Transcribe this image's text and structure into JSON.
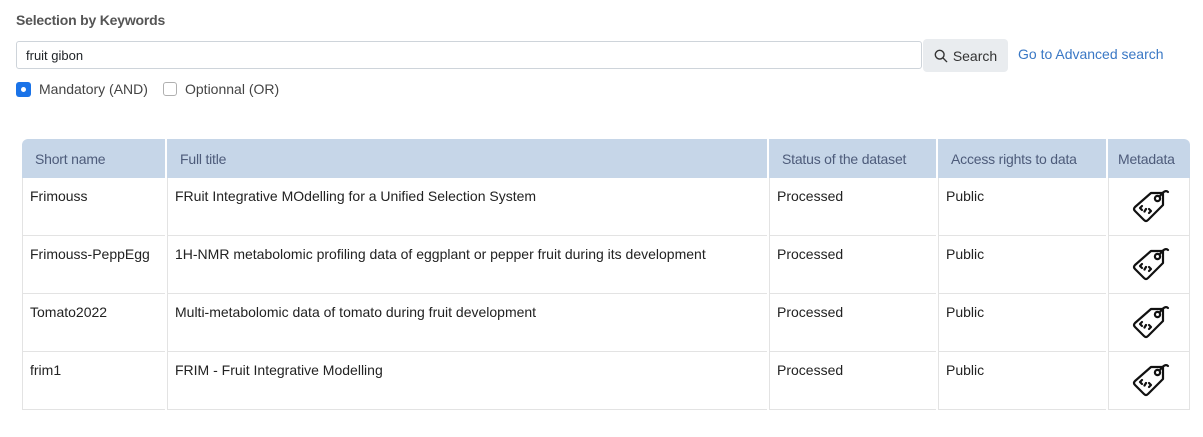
{
  "section": {
    "title": "Selection by Keywords"
  },
  "search": {
    "value": "fruit gibon",
    "button_label": "Search",
    "advanced_link": "Go to Advanced search"
  },
  "options": {
    "mandatory_label": "Mandatory (AND)",
    "optional_label": "Optionnal (OR)",
    "selected": "mandatory"
  },
  "table": {
    "headers": [
      "Short name",
      "Full title",
      "Status of the dataset",
      "Access rights to data",
      "Metadata"
    ],
    "rows": [
      {
        "short_name": "Frimouss",
        "full_title": "FRuit Integrative MOdelling for a Unified Selection System",
        "status": "Processed",
        "access": "Public",
        "metadata_icon": "tag-icon"
      },
      {
        "short_name": "Frimouss-PeppEgg",
        "full_title": "1H-NMR metabolomic profiling data of eggplant or pepper fruit during its development",
        "status": "Processed",
        "access": "Public",
        "metadata_icon": "tag-icon"
      },
      {
        "short_name": "Tomato2022",
        "full_title": "Multi-metabolomic data of tomato during fruit development",
        "status": "Processed",
        "access": "Public",
        "metadata_icon": "tag-icon"
      },
      {
        "short_name": "frim1",
        "full_title": "FRIM - Fruit Integrative Modelling",
        "status": "Processed",
        "access": "Public",
        "metadata_icon": "tag-icon"
      }
    ]
  },
  "colors": {
    "accent": "#1a73e8",
    "link": "#3a78c5",
    "header_bg": "#c6d6e8",
    "header_text": "#4d5b7a"
  }
}
